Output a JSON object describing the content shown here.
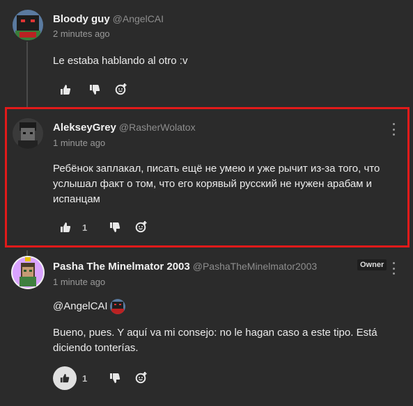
{
  "comments": [
    {
      "author": "Bloody guy",
      "handle": "@AngelCAI",
      "time": "2 minutes ago",
      "text": "Le estaba hablando al otro :v",
      "likes": ""
    },
    {
      "author": "AlekseyGrey",
      "handle": "@RasherWolatox",
      "time": "1 minute ago",
      "text": "Ребёнок заплакал, писать ещё не умею и уже рычит из-за того, что услышал факт о том, что его корявый русский не нужен арабам и испанцам",
      "likes": "1"
    },
    {
      "author": "Pasha The Minelmator 2003",
      "handle": "@PashaTheMinelmator2003",
      "time": "1 minute ago",
      "mention": "@AngelCAI",
      "text": "Bueno, pues. Y aquí va mi consejo: no le hagan caso a este tipo. Está diciendo tonterías.",
      "likes": "1",
      "badge": "Owner"
    }
  ],
  "colors": {
    "highlight": "#e21a1a",
    "background": "#2b2b2b"
  },
  "icons": [
    "like-icon",
    "dislike-icon",
    "reply-icon",
    "more-options-icon"
  ]
}
